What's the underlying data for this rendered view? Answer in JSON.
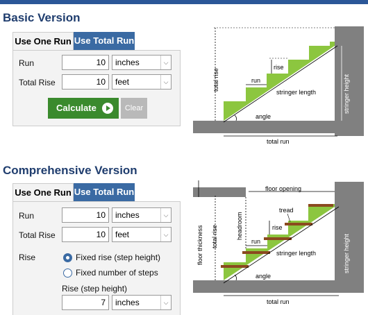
{
  "basic": {
    "title": "Basic Version",
    "tabs": [
      "Use One Run",
      "Use Total Run"
    ],
    "run": {
      "label": "Run",
      "value": "10",
      "unit": "inches"
    },
    "total_rise": {
      "label": "Total Rise",
      "value": "10",
      "unit": "feet"
    },
    "calculate_label": "Calculate",
    "clear_label": "Clear",
    "diagram": {
      "total_rise": "total rise",
      "rise": "rise",
      "run": "run",
      "stringer_length": "stringer length",
      "stringer_height": "stringer height",
      "angle": "angle",
      "total_run": "total run"
    }
  },
  "comprehensive": {
    "title": "Comprehensive Version",
    "tabs": [
      "Use One Run",
      "Use Total Run"
    ],
    "run": {
      "label": "Run",
      "value": "10",
      "unit": "inches"
    },
    "total_rise": {
      "label": "Total Rise",
      "value": "10",
      "unit": "feet"
    },
    "rise_label": "Rise",
    "rise_options": [
      "Fixed rise (step height)",
      "Fixed number of steps"
    ],
    "rise_selected": 0,
    "step_height": {
      "label": "Rise (step height)",
      "value": "7",
      "unit": "inches"
    },
    "diagram": {
      "floor_thickness": "floor thickness",
      "floor_opening": "floor opening",
      "total_rise": "total rise",
      "headroom": "headroom",
      "tread": "tread",
      "rise": "rise",
      "run": "run",
      "stringer_length": "stringer length",
      "stringer_height": "stringer height",
      "angle": "angle",
      "total_run": "total run"
    }
  },
  "colors": {
    "tab_blue": "#3a6aa3",
    "calc_green": "#3a8a2d",
    "stair_green": "#8cc63f",
    "gray": "#808080",
    "tread_brown": "#8b4a1f"
  }
}
